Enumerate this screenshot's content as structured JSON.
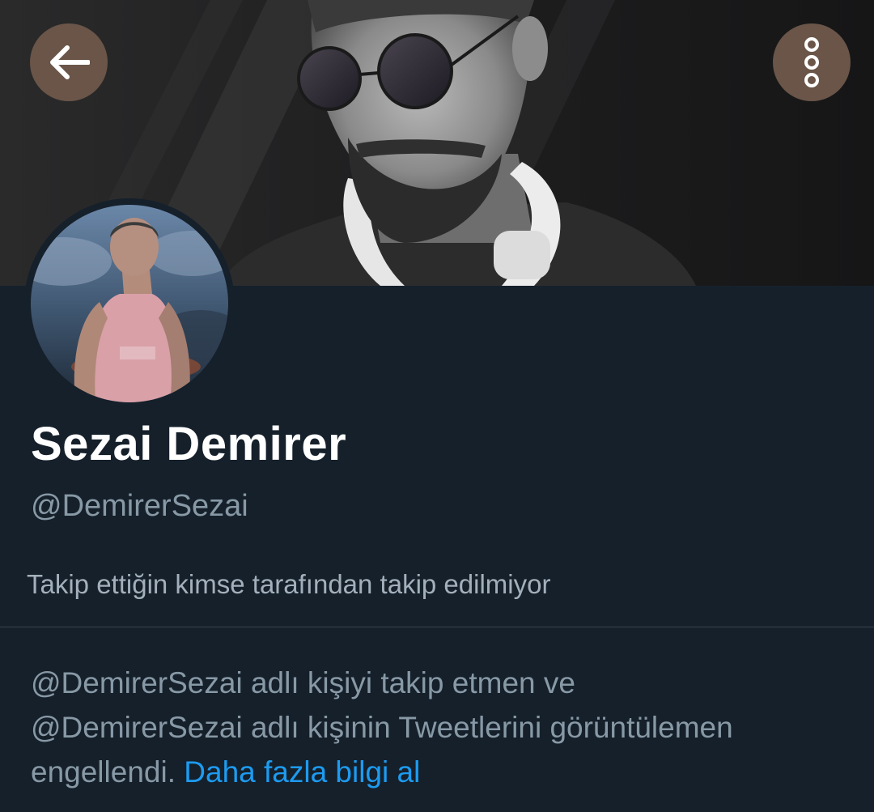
{
  "header": {
    "back_icon": "arrow-left-icon",
    "more_icon": "more-vertical-icon",
    "button_color": "#6a5548"
  },
  "profile": {
    "display_name": "Sezai Demirer",
    "handle": "@DemirerSezai",
    "followers_note": "Takip ettiğin kimse tarafından takip edilmiyor"
  },
  "block_notice": {
    "line1": "@DemirerSezai adlı kişiyi takip etmen ve",
    "line2": "@DemirerSezai adlı kişinin Tweetlerini görüntülemen",
    "line3": "engellendi.",
    "learn_more": "Daha fazla bilgi al"
  },
  "colors": {
    "background": "#15202b",
    "primary_text": "#ffffff",
    "secondary_text": "#8899a6",
    "link": "#1d9bf0",
    "divider": "#38444d"
  }
}
